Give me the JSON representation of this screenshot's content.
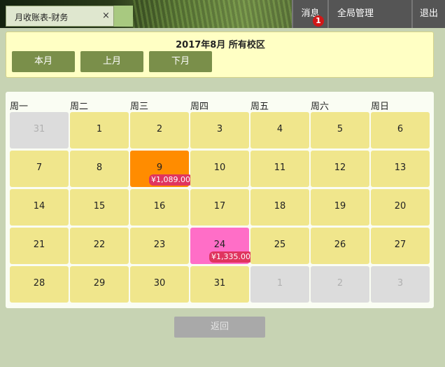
{
  "tab": {
    "label": "月收账表-财务",
    "close": "×"
  },
  "topnav": {
    "messages": "消息",
    "message_badge": "1",
    "global_admin": "全局管理",
    "logout": "退出"
  },
  "header": {
    "title": "2017年8月 所有校区",
    "buttons": {
      "this_month": "本月",
      "prev_month": "上月",
      "next_month": "下月"
    }
  },
  "calendar": {
    "weekdays": [
      "周一",
      "周二",
      "周三",
      "周四",
      "周五",
      "周六",
      "周日"
    ],
    "weeks": [
      [
        {
          "day": "31",
          "other": true
        },
        {
          "day": "1"
        },
        {
          "day": "2"
        },
        {
          "day": "3"
        },
        {
          "day": "4"
        },
        {
          "day": "5"
        },
        {
          "day": "6"
        }
      ],
      [
        {
          "day": "7"
        },
        {
          "day": "8"
        },
        {
          "day": "9",
          "status": "orange",
          "amount": "¥1,089.00"
        },
        {
          "day": "10"
        },
        {
          "day": "11"
        },
        {
          "day": "12"
        },
        {
          "day": "13"
        }
      ],
      [
        {
          "day": "14"
        },
        {
          "day": "15"
        },
        {
          "day": "16"
        },
        {
          "day": "17"
        },
        {
          "day": "18"
        },
        {
          "day": "19"
        },
        {
          "day": "20"
        }
      ],
      [
        {
          "day": "21"
        },
        {
          "day": "22"
        },
        {
          "day": "23"
        },
        {
          "day": "24",
          "status": "pink",
          "amount": "¥1,335.00"
        },
        {
          "day": "25"
        },
        {
          "day": "26"
        },
        {
          "day": "27"
        }
      ],
      [
        {
          "day": "28"
        },
        {
          "day": "29"
        },
        {
          "day": "30"
        },
        {
          "day": "31"
        },
        {
          "day": "1",
          "other": true
        },
        {
          "day": "2",
          "other": true
        },
        {
          "day": "3",
          "other": true
        }
      ]
    ]
  },
  "footer": {
    "back": "返回"
  },
  "colors": {
    "day": "#f0e68c",
    "day_other": "#dcdcdc",
    "day_orange": "#ff8c00",
    "day_pink": "#ff6ec7",
    "amount_badge": "#e0345f",
    "button_green": "#7a8f4a"
  }
}
